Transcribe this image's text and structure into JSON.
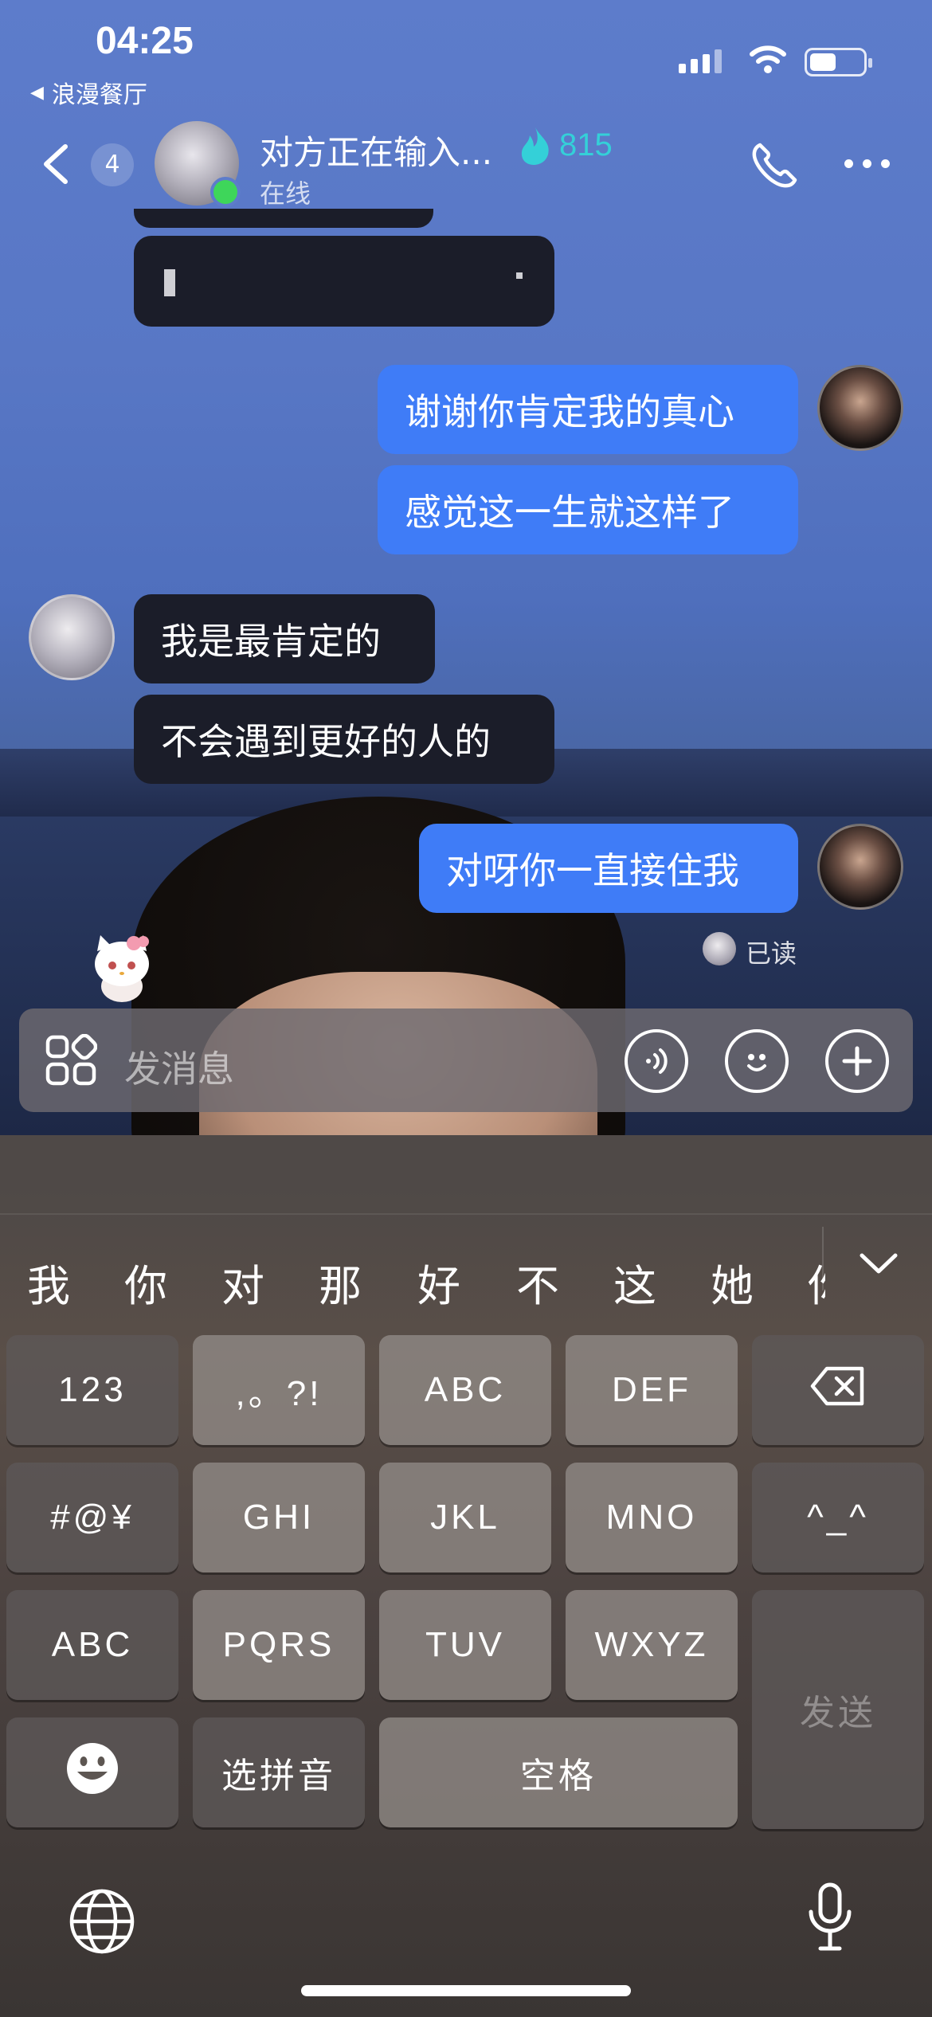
{
  "status_bar": {
    "time": "04:25",
    "back_app": "浪漫餐厅"
  },
  "header": {
    "unread_count": "4",
    "title": "对方正在输入...",
    "streak_count": "815",
    "subtitle": "在线",
    "accent_color": "#34d0d8"
  },
  "messages": [
    {
      "side": "in",
      "text": "",
      "redacted": true
    },
    {
      "side": "out",
      "text": "谢谢你肯定我的真心"
    },
    {
      "side": "out",
      "text": "感觉这一生就这样了"
    },
    {
      "side": "in",
      "text": "我是最肯定的"
    },
    {
      "side": "in",
      "text": "不会遇到更好的人的"
    },
    {
      "side": "out",
      "text": "对呀你一直接住我"
    }
  ],
  "read_receipt": "已读",
  "input": {
    "placeholder": "发消息"
  },
  "candidates": [
    "我",
    "你",
    "对",
    "那",
    "好",
    "不",
    "这",
    "她",
    "你"
  ],
  "keyboard": {
    "row1": [
      "123",
      ",。?!",
      "ABC",
      "DEF"
    ],
    "row2": [
      "#@¥",
      "GHI",
      "JKL",
      "MNO",
      "^_^"
    ],
    "row3": [
      "ABC",
      "PQRS",
      "TUV",
      "WXYZ"
    ],
    "row4": [
      "选拼音",
      "空格"
    ],
    "send": "发送"
  },
  "colors": {
    "outgoing_bubble": "#3f7cf7",
    "incoming_bubble": "#1b1d29",
    "online": "#3ed65a"
  }
}
